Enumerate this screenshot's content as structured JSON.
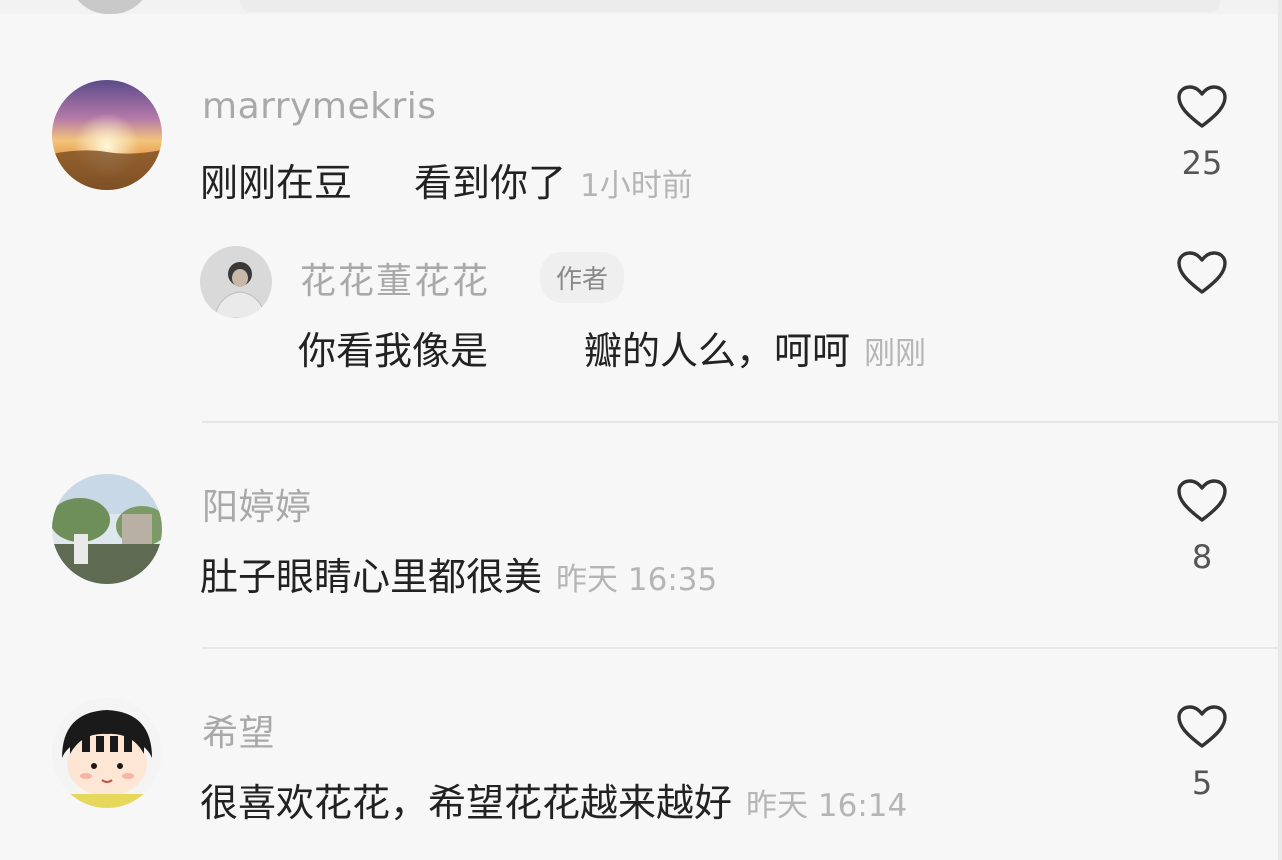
{
  "comments": [
    {
      "username": "marrymekris",
      "text_a": "刚刚在豆",
      "text_b": "看到你了",
      "time": "1小时前",
      "likes": "25",
      "reply": {
        "username": "花花董花花",
        "badge": "作者",
        "text_a": "你看我像是",
        "text_b": "瓣的人么，呵呵",
        "time": "刚刚"
      }
    },
    {
      "username": "阳婷婷",
      "text": "肚子眼睛心里都很美",
      "time": "昨天 16:35",
      "likes": "8"
    },
    {
      "username": "希望",
      "text": "很喜欢花花，希望花花越来越好",
      "time": "昨天 16:14",
      "likes": "5"
    }
  ],
  "icons": {
    "like": "heart-outline-icon"
  },
  "colors": {
    "background": "#f7f7f7",
    "username": "#a9a9a9",
    "text": "#222222",
    "time": "#b5b5b5"
  }
}
